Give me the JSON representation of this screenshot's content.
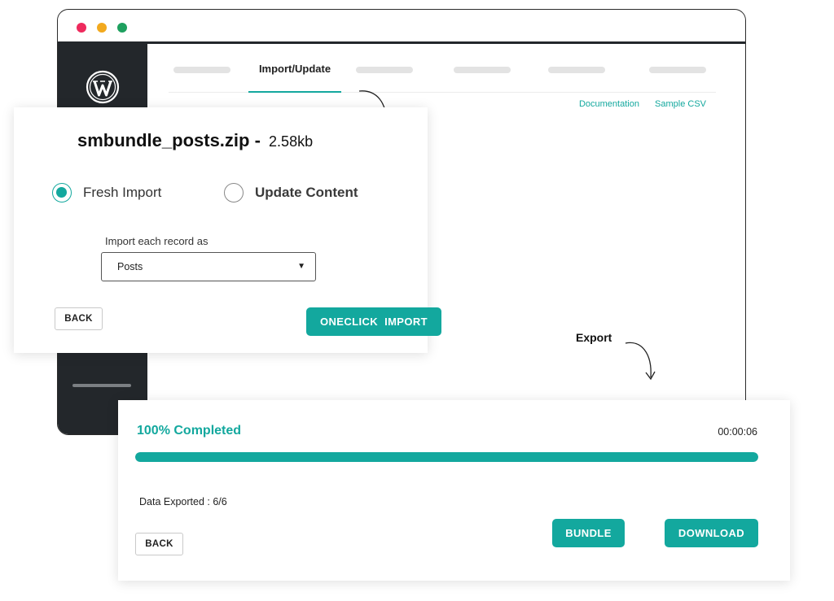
{
  "colors": {
    "accent": "#13a89e",
    "sidebar": "#23272b",
    "dot_red": "#ee2a5d",
    "dot_yellow": "#f2a91e",
    "dot_green": "#1ea05f"
  },
  "window": {
    "nav_active_tab": "Import/Update",
    "logo_icon": "wordpress-icon"
  },
  "links": {
    "documentation": "Documentation",
    "sample_csv": "Sample CSV"
  },
  "import": {
    "file_name": "smbundle_posts.zip",
    "separator": " - ",
    "file_size": "2.58kb",
    "options": [
      {
        "label": "Fresh Import",
        "checked": true
      },
      {
        "label": "Update Content",
        "checked": false
      }
    ],
    "record_label": "Import each record as",
    "record_value": "Posts",
    "back_label": "BACK",
    "import_label": "ONECLICK  IMPORT"
  },
  "export": {
    "section_label": "Export",
    "status": "100% Completed",
    "progress": 1.0,
    "elapsed": "00:00:06",
    "data_exported": "Data Exported : 6/6",
    "back_label": "BACK",
    "bundle_label": "BUNDLE",
    "download_label": "DOWNLOAD"
  }
}
